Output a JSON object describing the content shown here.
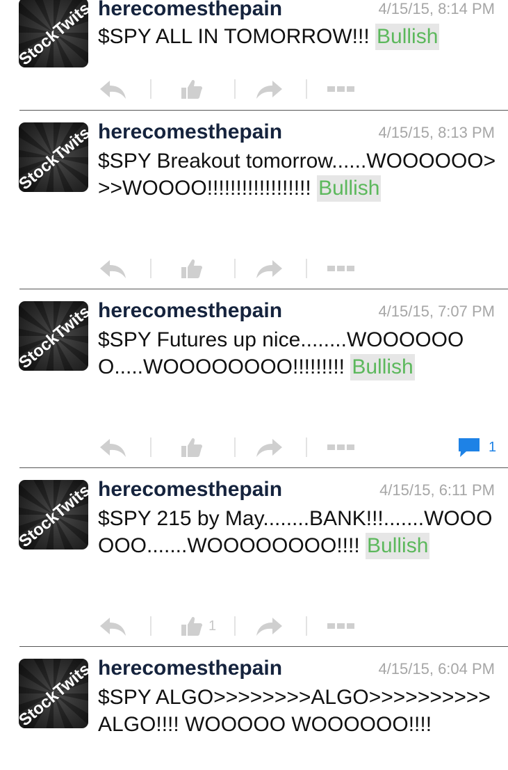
{
  "colors": {
    "username": "#15233d",
    "timestamp": "#a6a6a6",
    "bullish_text": "#5cb85c",
    "bullish_bg": "#e6e6e6",
    "action_icon": "#cfcfcf",
    "comment_icon": "#1e82e6"
  },
  "avatar": {
    "brand": "StockTwits"
  },
  "icons": {
    "reply": "reply-icon",
    "like": "thumbs-up-icon",
    "share": "share-arrow-icon",
    "more": "more-icon",
    "comment": "comment-bubble-icon"
  },
  "posts": [
    {
      "username": "herecomesthepain",
      "timestamp": "4/15/15, 8:14 PM",
      "text": "$SPY ALL IN TOMORROW!!! ",
      "sentiment": "Bullish",
      "likes": "",
      "comments": ""
    },
    {
      "username": "herecomesthepain",
      "timestamp": "4/15/15, 8:13 PM",
      "text": "$SPY Breakout tomorrow......WOOOOOO>>>WOOOO!!!!!!!!!!!!!!!!!! ",
      "sentiment": "Bullish",
      "likes": "",
      "comments": ""
    },
    {
      "username": "herecomesthepain",
      "timestamp": "4/15/15, 7:07 PM",
      "text": "$SPY Futures up nice........WOOOOOOO.....WOOOOOOOO!!!!!!!!! ",
      "sentiment": "Bullish",
      "likes": "",
      "comments": "1"
    },
    {
      "username": "herecomesthepain",
      "timestamp": "4/15/15, 6:11 PM",
      "text": "$SPY 215 by May........BANK!!!.......WOOOOOO.......WOOOOOOOO!!!! ",
      "sentiment": "Bullish",
      "likes": "1",
      "comments": ""
    },
    {
      "username": "herecomesthepain",
      "timestamp": "4/15/15, 6:04 PM",
      "text": "$SPY ALGO>>>>>>>>ALGO>>>>>>>>>>ALGO!!!!    WOOOOO   WOOOOOO!!!!",
      "sentiment": "",
      "likes": "",
      "comments": ""
    }
  ]
}
